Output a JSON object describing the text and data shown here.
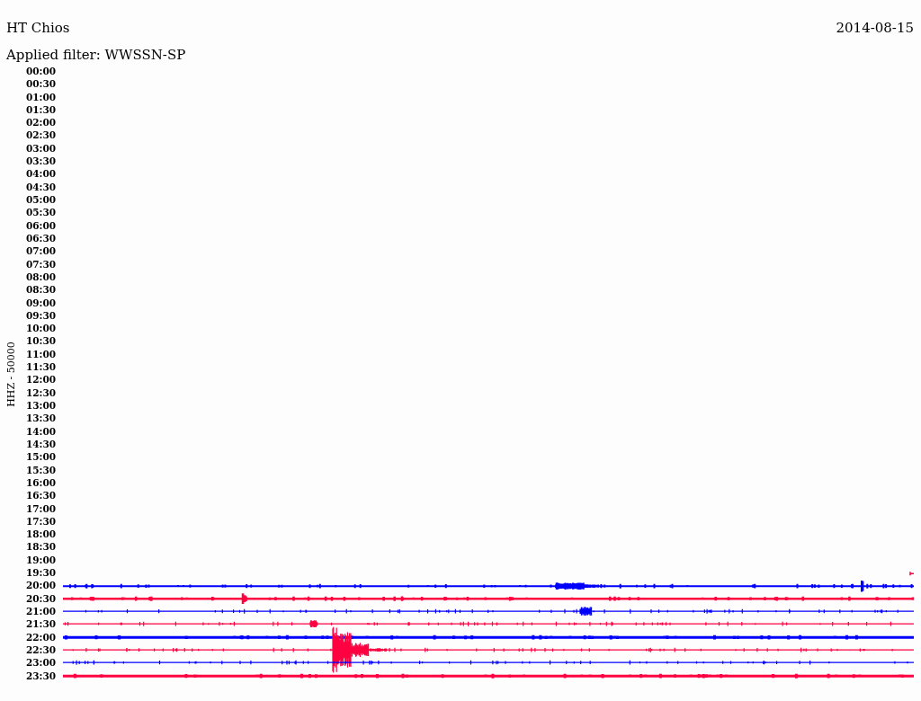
{
  "header": {
    "station": "HT Chios",
    "date": "2014-08-15",
    "filter": "Applied filter: WWSSN-SP"
  },
  "channel_label": "HHZ - 50000",
  "rows": [
    {
      "time": "00:00",
      "kind": "empty"
    },
    {
      "time": "00:30",
      "kind": "empty"
    },
    {
      "time": "01:00",
      "kind": "empty"
    },
    {
      "time": "01:30",
      "kind": "empty"
    },
    {
      "time": "02:00",
      "kind": "empty"
    },
    {
      "time": "02:30",
      "kind": "empty"
    },
    {
      "time": "03:00",
      "kind": "empty"
    },
    {
      "time": "03:30",
      "kind": "empty"
    },
    {
      "time": "04:00",
      "kind": "empty"
    },
    {
      "time": "04:30",
      "kind": "empty"
    },
    {
      "time": "05:00",
      "kind": "empty"
    },
    {
      "time": "05:30",
      "kind": "empty"
    },
    {
      "time": "06:00",
      "kind": "empty"
    },
    {
      "time": "06:30",
      "kind": "empty"
    },
    {
      "time": "07:00",
      "kind": "empty"
    },
    {
      "time": "07:30",
      "kind": "empty"
    },
    {
      "time": "08:00",
      "kind": "empty"
    },
    {
      "time": "08:30",
      "kind": "empty"
    },
    {
      "time": "09:00",
      "kind": "empty"
    },
    {
      "time": "09:30",
      "kind": "empty"
    },
    {
      "time": "10:00",
      "kind": "empty"
    },
    {
      "time": "10:30",
      "kind": "empty"
    },
    {
      "time": "11:00",
      "kind": "empty"
    },
    {
      "time": "11:30",
      "kind": "empty"
    },
    {
      "time": "12:00",
      "kind": "empty"
    },
    {
      "time": "12:30",
      "kind": "empty"
    },
    {
      "time": "13:00",
      "kind": "empty"
    },
    {
      "time": "13:30",
      "kind": "empty"
    },
    {
      "time": "14:00",
      "kind": "empty"
    },
    {
      "time": "14:30",
      "kind": "empty"
    },
    {
      "time": "15:00",
      "kind": "empty"
    },
    {
      "time": "15:30",
      "kind": "empty"
    },
    {
      "time": "16:00",
      "kind": "empty"
    },
    {
      "time": "16:30",
      "kind": "empty"
    },
    {
      "time": "17:00",
      "kind": "empty"
    },
    {
      "time": "17:30",
      "kind": "empty"
    },
    {
      "time": "18:00",
      "kind": "empty"
    },
    {
      "time": "18:30",
      "kind": "empty"
    },
    {
      "time": "19:00",
      "kind": "empty"
    },
    {
      "time": "19:30",
      "kind": "stub",
      "color": "#ff0040"
    },
    {
      "time": "20:00",
      "kind": "trace",
      "color": "#0000ff"
    },
    {
      "time": "20:30",
      "kind": "trace",
      "color": "#ff0040"
    },
    {
      "time": "21:00",
      "kind": "trace",
      "color": "#0000ff"
    },
    {
      "time": "21:30",
      "kind": "trace",
      "color": "#ff0040"
    },
    {
      "time": "22:00",
      "kind": "trace",
      "color": "#0000ff"
    },
    {
      "time": "22:30",
      "kind": "trace",
      "color": "#ff0040"
    },
    {
      "time": "23:00",
      "kind": "trace",
      "color": "#0000ff"
    },
    {
      "time": "23:30",
      "kind": "trace",
      "color": "#ff0040"
    }
  ]
}
